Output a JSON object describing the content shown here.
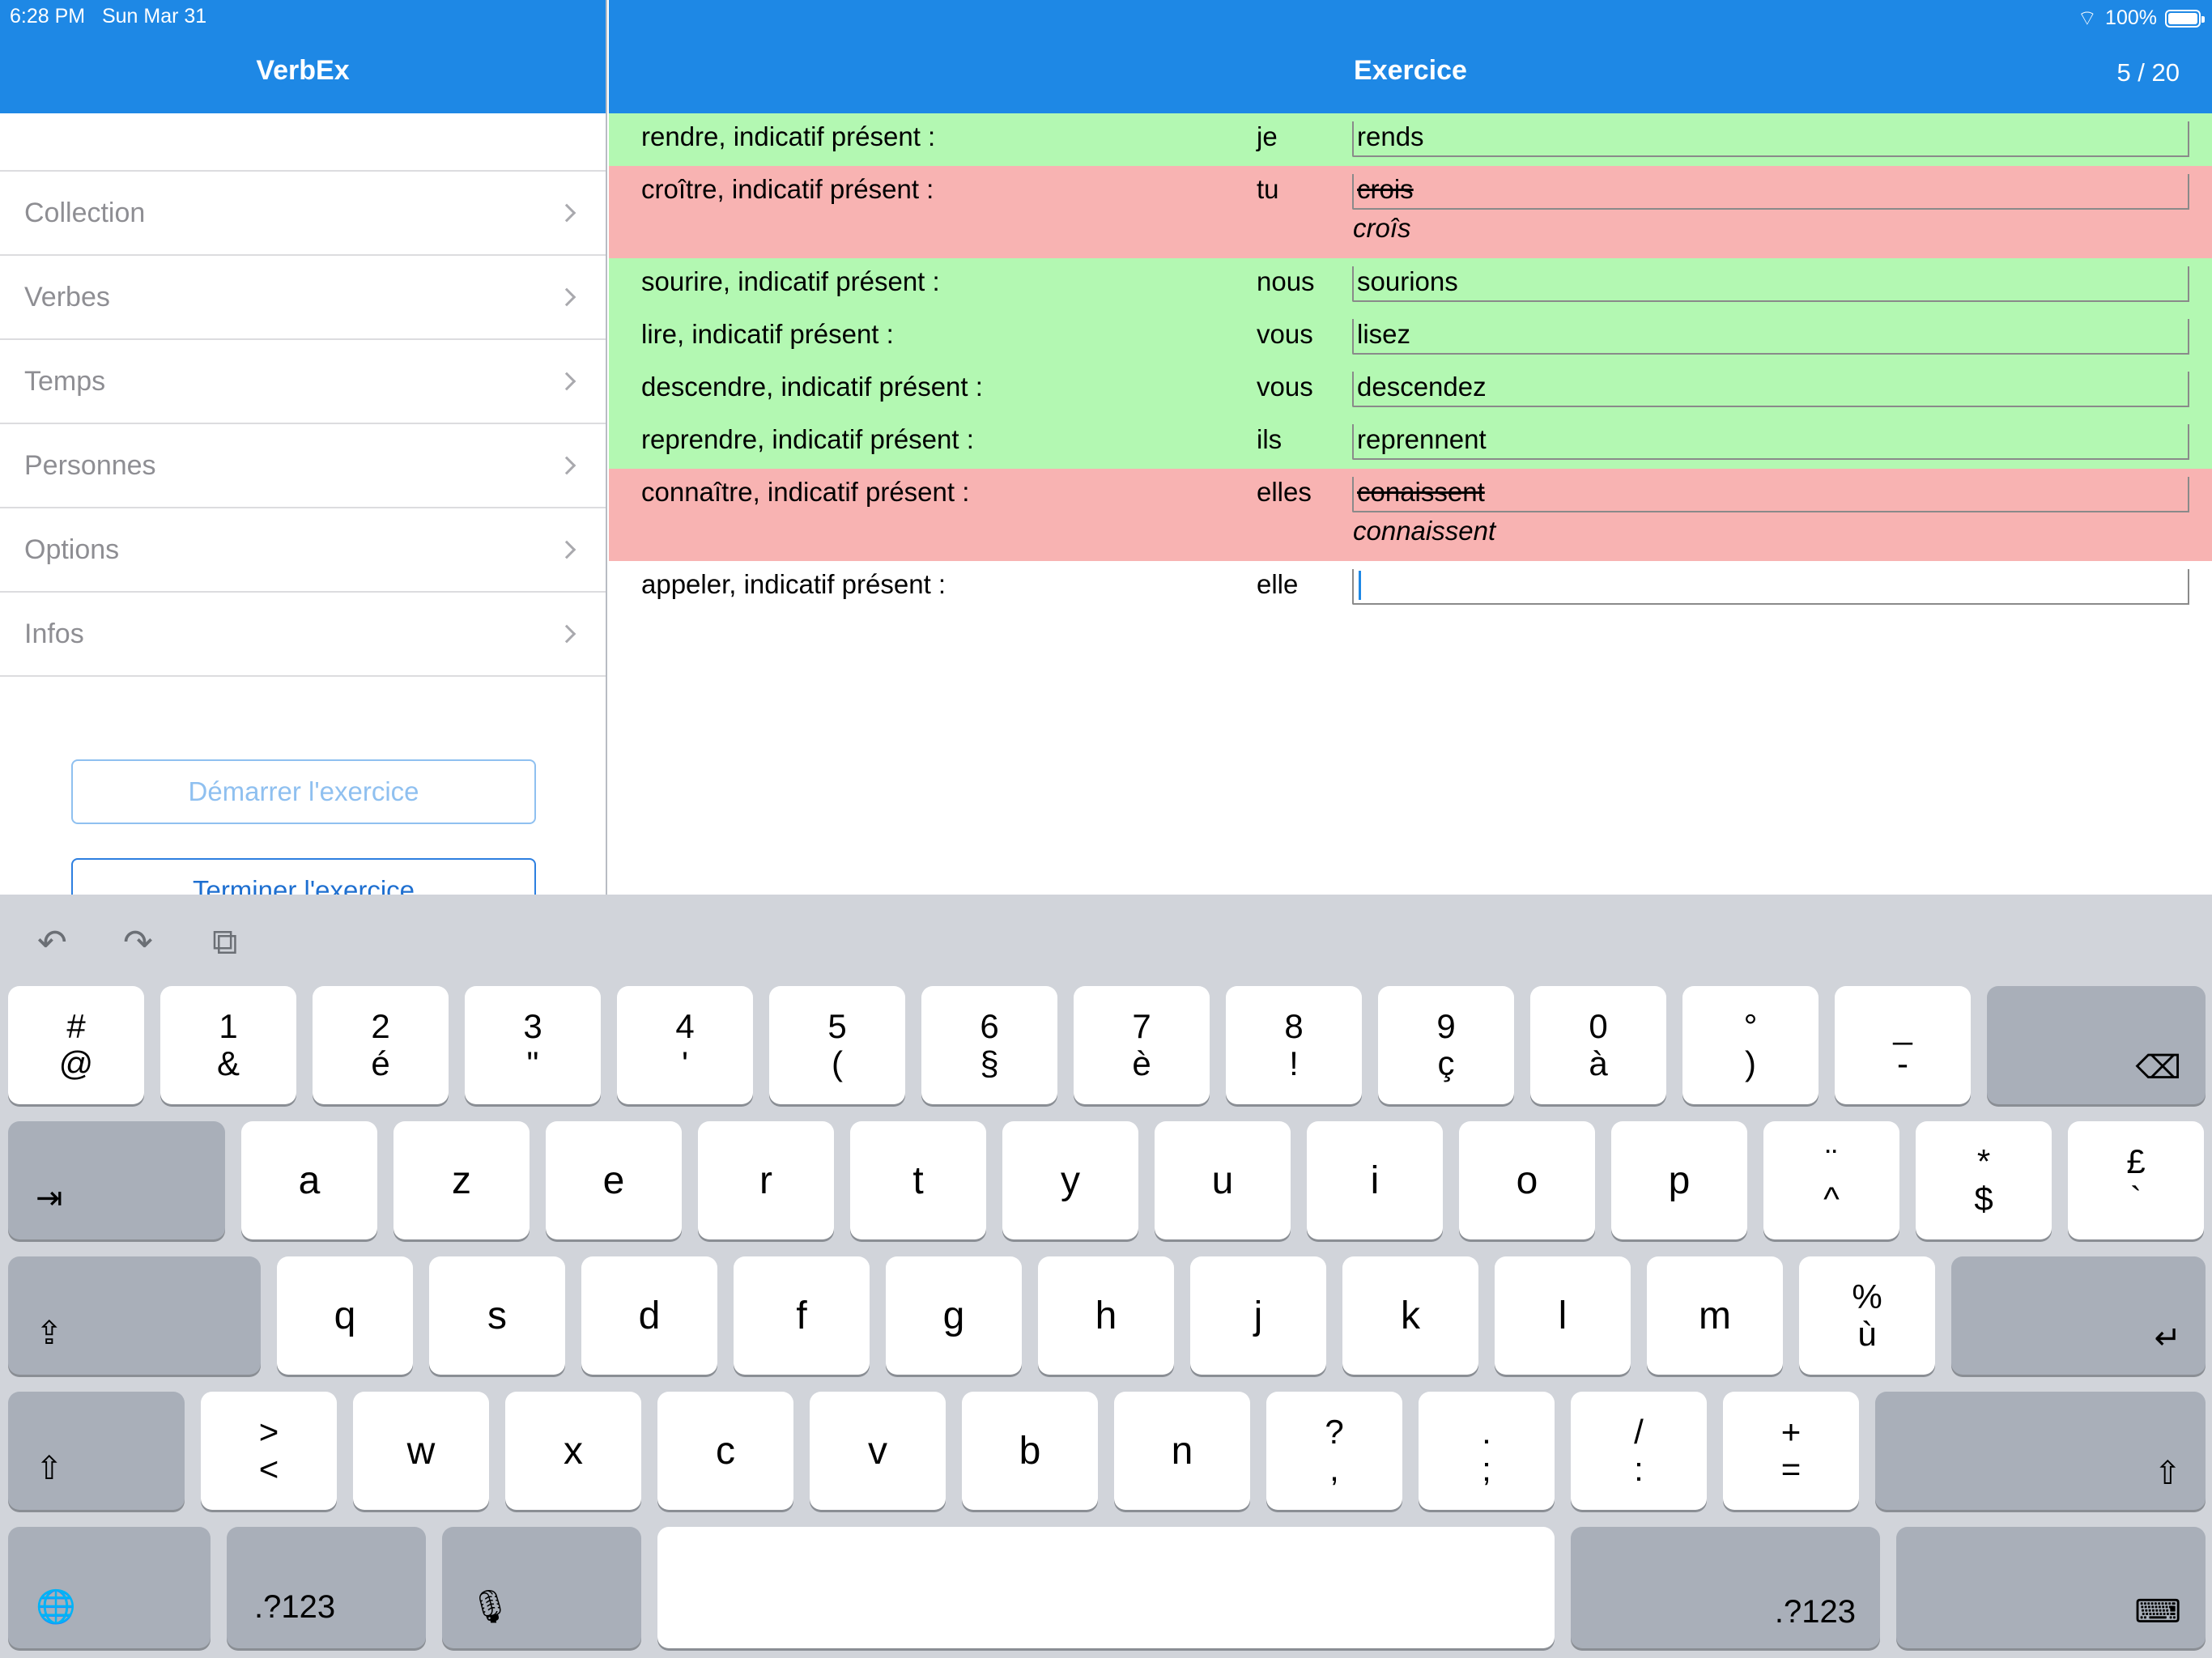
{
  "status_bar": {
    "time": "6:28 PM",
    "date": "Sun Mar 31",
    "battery": "100%",
    "battery_level": 1.0
  },
  "master": {
    "title": "VerbEx",
    "menu": [
      {
        "label": "Collection"
      },
      {
        "label": "Verbes"
      },
      {
        "label": "Temps"
      },
      {
        "label": "Personnes"
      },
      {
        "label": "Options"
      },
      {
        "label": "Infos"
      }
    ],
    "start_button": "Démarrer l'exercice",
    "end_button": "Terminer l'exercice"
  },
  "detail": {
    "title": "Exercice",
    "counter": "5 / 20",
    "rows": [
      {
        "verb": "rendre, indicatif présent :",
        "person": "je",
        "answer": "rends",
        "status": "ok"
      },
      {
        "verb": "croître, indicatif présent :",
        "person": "tu",
        "answer": "crois",
        "correction": "croîs",
        "status": "bad"
      },
      {
        "verb": "sourire, indicatif présent :",
        "person": "nous",
        "answer": "sourions",
        "status": "ok"
      },
      {
        "verb": "lire, indicatif présent :",
        "person": "vous",
        "answer": "lisez",
        "status": "ok"
      },
      {
        "verb": "descendre, indicatif présent :",
        "person": "vous",
        "answer": "descendez",
        "status": "ok"
      },
      {
        "verb": "reprendre, indicatif présent :",
        "person": "ils",
        "answer": "reprennent",
        "status": "ok"
      },
      {
        "verb": "connaître, indicatif présent :",
        "person": "elles",
        "answer": "conaissent",
        "correction": "connaissent",
        "status": "bad"
      },
      {
        "verb": "appeler, indicatif présent :",
        "person": "elle",
        "answer": "",
        "status": "active"
      }
    ]
  },
  "keyboard": {
    "shortcuts": [
      {
        "icon": "undo-icon",
        "glyph": "↶"
      },
      {
        "icon": "redo-icon",
        "glyph": "↷"
      },
      {
        "icon": "paste-icon",
        "glyph": "⧉"
      }
    ],
    "row1": [
      {
        "top": "#",
        "bot": "@"
      },
      {
        "top": "1",
        "bot": "&"
      },
      {
        "top": "2",
        "bot": "é"
      },
      {
        "top": "3",
        "bot": "\""
      },
      {
        "top": "4",
        "bot": "'"
      },
      {
        "top": "5",
        "bot": "("
      },
      {
        "top": "6",
        "bot": "§"
      },
      {
        "top": "7",
        "bot": "è"
      },
      {
        "top": "8",
        "bot": "!"
      },
      {
        "top": "9",
        "bot": "ç"
      },
      {
        "top": "0",
        "bot": "à"
      },
      {
        "top": "°",
        "bot": ")"
      },
      {
        "top": "_",
        "bot": "-"
      }
    ],
    "row2": [
      {
        "top": "a"
      },
      {
        "top": "z"
      },
      {
        "top": "e"
      },
      {
        "top": "r"
      },
      {
        "top": "t"
      },
      {
        "top": "y"
      },
      {
        "top": "u"
      },
      {
        "top": "i"
      },
      {
        "top": "o"
      },
      {
        "top": "p"
      },
      {
        "top": "¨",
        "bot": "^"
      },
      {
        "top": "*",
        "bot": "$"
      },
      {
        "top": "£",
        "bot": "`"
      }
    ],
    "row3": [
      {
        "top": "q"
      },
      {
        "top": "s"
      },
      {
        "top": "d"
      },
      {
        "top": "f"
      },
      {
        "top": "g"
      },
      {
        "top": "h"
      },
      {
        "top": "j"
      },
      {
        "top": "k"
      },
      {
        "top": "l"
      },
      {
        "top": "m"
      },
      {
        "top": "%",
        "bot": "ù"
      }
    ],
    "row4": [
      {
        "top": ">",
        "bot": "<"
      },
      {
        "top": "w"
      },
      {
        "top": "x"
      },
      {
        "top": "c"
      },
      {
        "top": "v"
      },
      {
        "top": "b"
      },
      {
        "top": "n"
      },
      {
        "top": "?",
        "bot": ","
      },
      {
        "top": ".",
        "bot": ";"
      },
      {
        "top": "/",
        "bot": ":"
      },
      {
        "top": "+",
        "bot": "="
      }
    ],
    "tab_glyph": "⇥",
    "caps_glyph": "⇪",
    "shift_glyph": "⇧",
    "delete_glyph": "⌫",
    "return_glyph": "↵",
    "globe_glyph": "🌐",
    "mic_glyph": "🎙",
    "hide_glyph": "⌨",
    "numbers_label": ".?123"
  }
}
